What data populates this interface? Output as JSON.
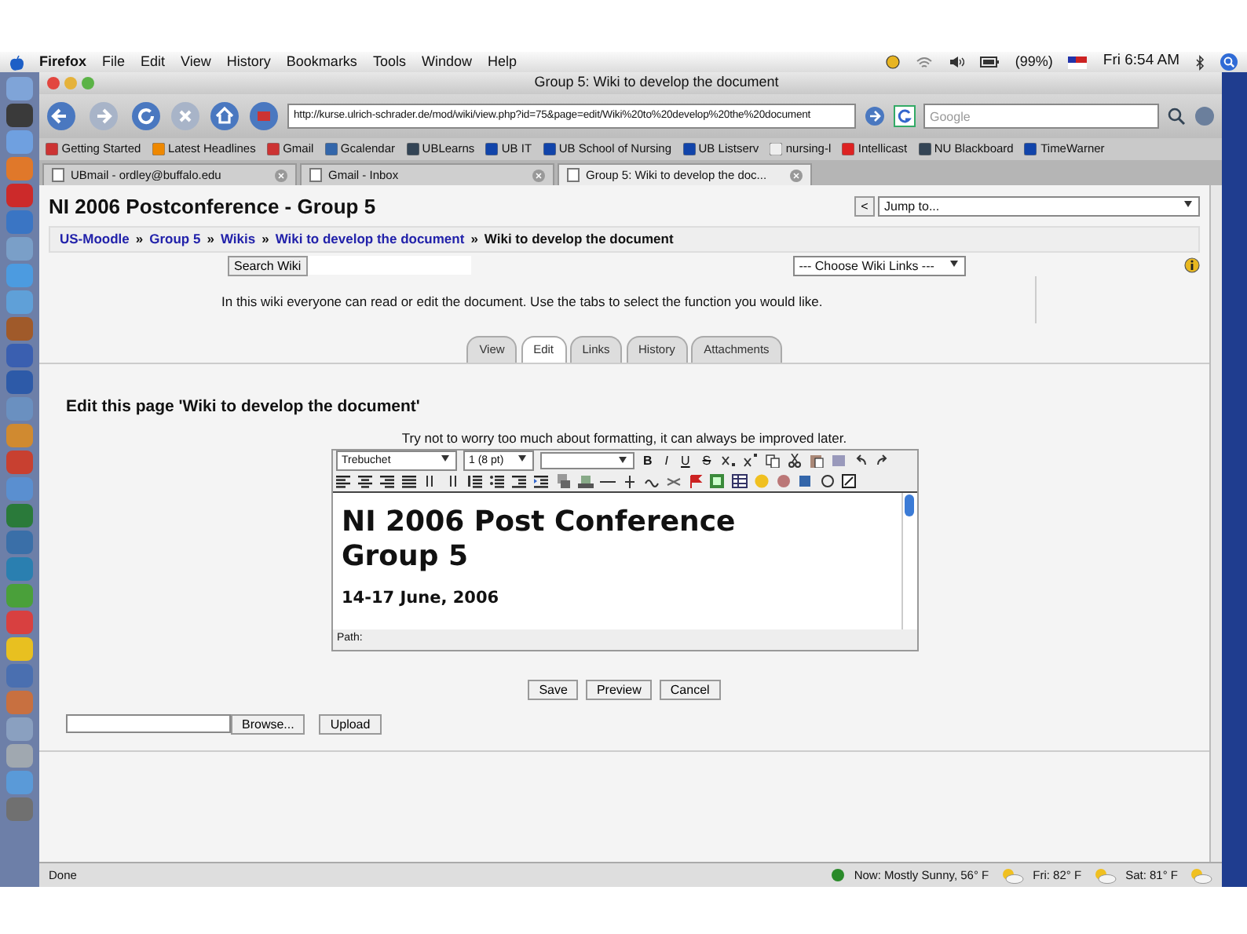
{
  "menu_bar": {
    "items": [
      "Firefox",
      "File",
      "Edit",
      "View",
      "History",
      "Bookmarks",
      "Tools",
      "Window",
      "Help"
    ],
    "battery": "(99%)",
    "clock": "Fri 6:54 AM"
  },
  "window": {
    "title": "Group 5: Wiki to develop the document"
  },
  "toolbar": {
    "url": "http://kurse.ulrich-schrader.de/mod/wiki/view.php?id=75&page=edit/Wiki%20to%20develop%20the%20document",
    "search_placeholder": "Google"
  },
  "bookmarks": [
    "Getting Started",
    "Latest Headlines",
    "Gmail",
    "Gcalendar",
    "UBLearns",
    "UB IT",
    "UB School of Nursing",
    "UB Listserv",
    "nursing-l",
    "Intellicast",
    "NU Blackboard",
    "TimeWarner"
  ],
  "tabs": [
    {
      "label": "UBmail - ordley@buffalo.edu",
      "selected": false
    },
    {
      "label": "Gmail - Inbox",
      "selected": false
    },
    {
      "label": "Group 5: Wiki to develop the doc...",
      "selected": true
    }
  ],
  "page": {
    "course_title": "NI 2006 Postconference - Group 5",
    "jump_prev": "<",
    "jump_label": "Jump to...",
    "breadcrumb": [
      {
        "label": "US-Moodle",
        "link": true
      },
      {
        "label": "Group 5",
        "link": true
      },
      {
        "label": "Wikis",
        "link": true
      },
      {
        "label": "Wiki to develop the document",
        "link": true
      },
      {
        "label": "Wiki to develop the document",
        "link": false
      }
    ],
    "separator": "»",
    "search_button": "Search Wiki",
    "wiki_links": "--- Choose Wiki Links ---",
    "intro": "In this wiki everyone can read or edit the document. Use the tabs to select the function you would like.",
    "wiki_tabs": [
      {
        "label": "View",
        "selected": false
      },
      {
        "label": "Edit",
        "selected": true
      },
      {
        "label": "Links",
        "selected": false
      },
      {
        "label": "History",
        "selected": false
      },
      {
        "label": "Attachments",
        "selected": false
      }
    ],
    "heading": "Edit this page 'Wiki to develop the document'",
    "hint": "Try not to worry too much about formatting, it can always be improved later.",
    "editor": {
      "font": "Trebuchet",
      "size": "1 (8 pt)",
      "format_buttons": [
        "B",
        "I",
        "U",
        "S"
      ],
      "content_heading": [
        "NI 2006 Post Conference",
        "Group 5"
      ],
      "content_date": "14-17 June, 2006",
      "path_label": "Path:"
    },
    "buttons": [
      "Save",
      "Preview",
      "Cancel"
    ],
    "browse": "Browse...",
    "upload": "Upload"
  },
  "status_bar": {
    "text": "Done",
    "weather": [
      "Now: Mostly Sunny, 56° F",
      "Fri: 82° F",
      "Sat: 81° F"
    ]
  }
}
